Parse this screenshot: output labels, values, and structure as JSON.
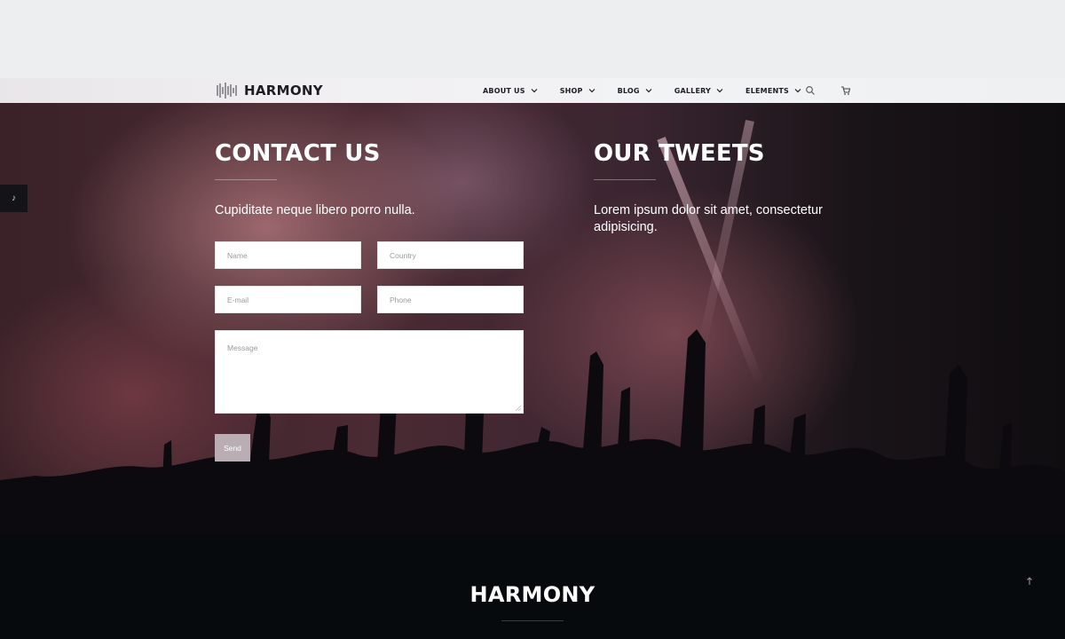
{
  "brand": {
    "name": "HARMONY"
  },
  "nav": {
    "items": [
      {
        "label": "ABOUT US"
      },
      {
        "label": "SHOP"
      },
      {
        "label": "BLOG"
      },
      {
        "label": "GALLERY"
      },
      {
        "label": "ELEMENTS"
      }
    ],
    "icons": [
      "search-icon",
      "cart-icon",
      "chevron-down-icon"
    ]
  },
  "side_tab": {
    "icon": "music-note-icon",
    "glyph": "♪"
  },
  "contact": {
    "title": "CONTACT US",
    "lead": "Cupiditate neque libero porro nulla.",
    "fields": {
      "name_placeholder": "Name",
      "country_placeholder": "Country",
      "email_placeholder": "E-mail",
      "phone_placeholder": "Phone",
      "message_placeholder": "Message"
    },
    "send_label": "Send"
  },
  "tweets": {
    "title": "OUR TWEETS",
    "text": "Lorem ipsum dolor sit amet, consectetur adipisicing."
  },
  "footer": {
    "brand": "HARMONY",
    "to_top_icon": "arrow-up-icon"
  },
  "colors": {
    "page_bg": "#eceef0",
    "footer_bg": "#070a0c",
    "send_button": "#b9aeb3",
    "text_on_dark": "#ffffff"
  }
}
